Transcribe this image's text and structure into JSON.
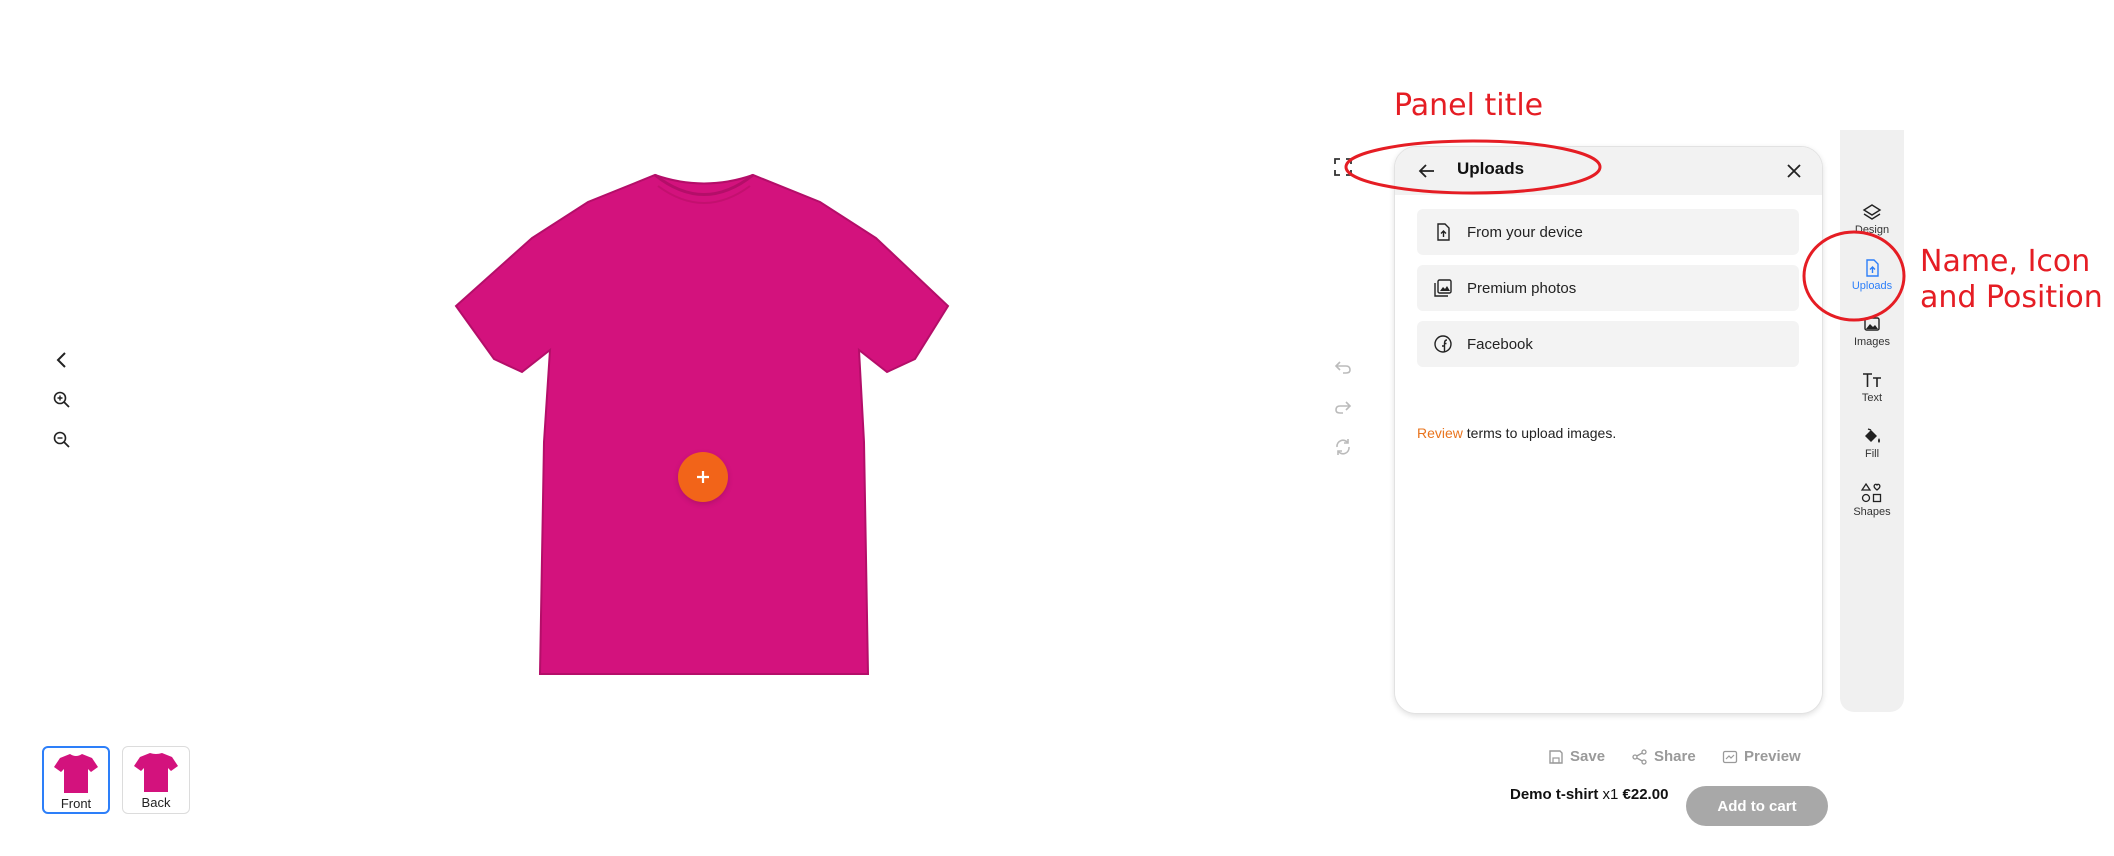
{
  "annotations": {
    "panel_title_note": "Panel title",
    "sidebar_note_line1": "Name, Icon",
    "sidebar_note_line2": "and Position",
    "color": "#e51d24"
  },
  "canvas": {
    "shirt_color": "#d3127d",
    "add_button_color": "#f26419",
    "add_button_symbol": "+"
  },
  "views": [
    {
      "label": "Front",
      "active": true
    },
    {
      "label": "Back",
      "active": false
    }
  ],
  "panel": {
    "title": "Uploads",
    "items": [
      {
        "label": "From your device",
        "icon": "file-upload-icon"
      },
      {
        "label": "Premium photos",
        "icon": "photos-icon"
      },
      {
        "label": "Facebook",
        "icon": "facebook-icon"
      }
    ],
    "terms_link": "Review",
    "terms_text": " terms to upload images."
  },
  "sidebar": {
    "items": [
      {
        "label": "Design",
        "icon": "layers-icon",
        "active": false
      },
      {
        "label": "Uploads",
        "icon": "upload-file-icon",
        "active": true
      },
      {
        "label": "Images",
        "icon": "image-icon",
        "active": false
      },
      {
        "label": "Text",
        "icon": "text-icon",
        "active": false
      },
      {
        "label": "Fill",
        "icon": "paint-bucket-icon",
        "active": false
      },
      {
        "label": "Shapes",
        "icon": "shapes-icon",
        "active": false
      }
    ],
    "accent_color": "#2d7ff9"
  },
  "actions": {
    "save": "Save",
    "share": "Share",
    "preview": "Preview"
  },
  "product": {
    "name": "Demo t-shirt",
    "quantity": "x1",
    "price": "€22.00",
    "cart_button": "Add to cart"
  }
}
